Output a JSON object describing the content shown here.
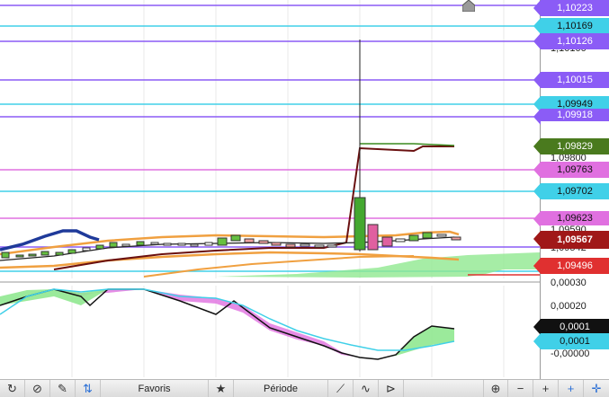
{
  "price_scale": {
    "levels": [
      {
        "value": "1,10223",
        "color": "#8b5cf6",
        "text_color": "#ffffff"
      },
      {
        "value": "1,10169",
        "color": "#40d0e8",
        "text_color": "#111111"
      },
      {
        "value": "1,10126",
        "color": "#8b5cf6",
        "text_color": "#ffffff"
      },
      {
        "value": "1,10015",
        "color": "#8b5cf6",
        "text_color": "#ffffff"
      },
      {
        "value": "1,09949",
        "color": "#40d0e8",
        "text_color": "#111111"
      },
      {
        "value": "1,09918",
        "color": "#8b5cf6",
        "text_color": "#ffffff"
      },
      {
        "value": "1,09829",
        "color": "#4a7a1e",
        "text_color": "#ffffff"
      },
      {
        "value": "1,09763",
        "color": "#e070e0",
        "text_color": "#111111"
      },
      {
        "value": "1,09702",
        "color": "#40d0e8",
        "text_color": "#111111"
      },
      {
        "value": "1,09623",
        "color": "#e070e0",
        "text_color": "#111111"
      },
      {
        "value": "1,09567",
        "color": "#a01818",
        "text_color": "#ffffff"
      },
      {
        "value": "1,09496",
        "color": "#e03030",
        "text_color": "#ffffff"
      }
    ],
    "partial_labels": [
      "1,10100",
      "1,09800",
      "1,09590",
      "1,09542"
    ]
  },
  "oscillator": {
    "axis_labels": [
      "0,00030",
      "0,00020",
      "-0,00000"
    ],
    "tags": [
      {
        "value": "0,0001",
        "color": "#111111",
        "text_color": "#ffffff"
      },
      {
        "value": "0,0001",
        "color": "#40d0e8",
        "text_color": "#111111"
      }
    ]
  },
  "toolbar": {
    "icons": [
      "refresh-icon",
      "no-entry-icon",
      "pencil-icon",
      "sort-arrows-icon"
    ],
    "favorites_label": "Favoris",
    "period_label": "Période",
    "right_icons": [
      "zoom-in-icon",
      "minus-icon",
      "plus-icon",
      "crosshair-icon",
      "crosshair-alt-icon"
    ]
  },
  "colors": {
    "purple": "#8b5cf6",
    "cyan": "#40d0e8",
    "magenta": "#e070e0",
    "green": "#4a7a1e",
    "dark_red": "#a01818",
    "red": "#e03030",
    "orange": "#f0a040",
    "navy": "#1f3a9a"
  }
}
